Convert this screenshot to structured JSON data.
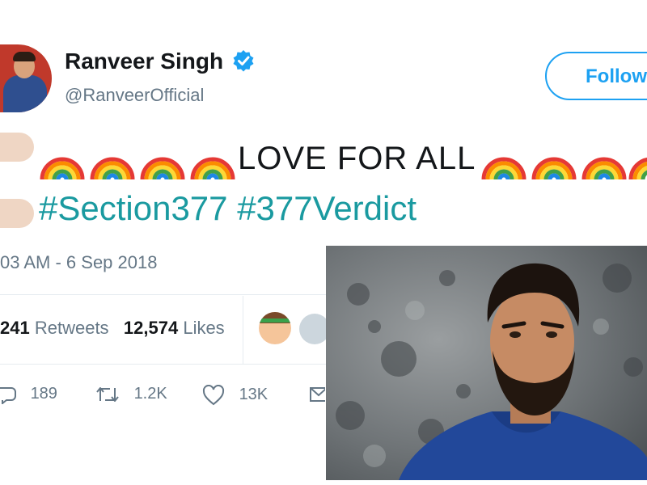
{
  "profile": {
    "display_name": "Ranveer Singh",
    "handle": "@RanveerOfficial",
    "verified_color": "#1da1f2"
  },
  "follow_button": {
    "label": "Follow"
  },
  "tweet": {
    "text": "LOVE FOR ALL",
    "hashtags": "#Section377 #377Verdict",
    "emoji": [
      "raised-hand",
      "rainbow"
    ]
  },
  "meta": {
    "timestamp": "03 AM - 6 Sep 2018",
    "retweets_count": "241",
    "retweets_label": "Retweets",
    "likes_count": "12,574",
    "likes_label": "Likes"
  },
  "actions": {
    "replies": "189",
    "retweets": "1.2K",
    "likes": "13K"
  },
  "colors": {
    "accent": "#1da1f2",
    "hashtag": "#1a9aa0",
    "muted": "#657786"
  }
}
